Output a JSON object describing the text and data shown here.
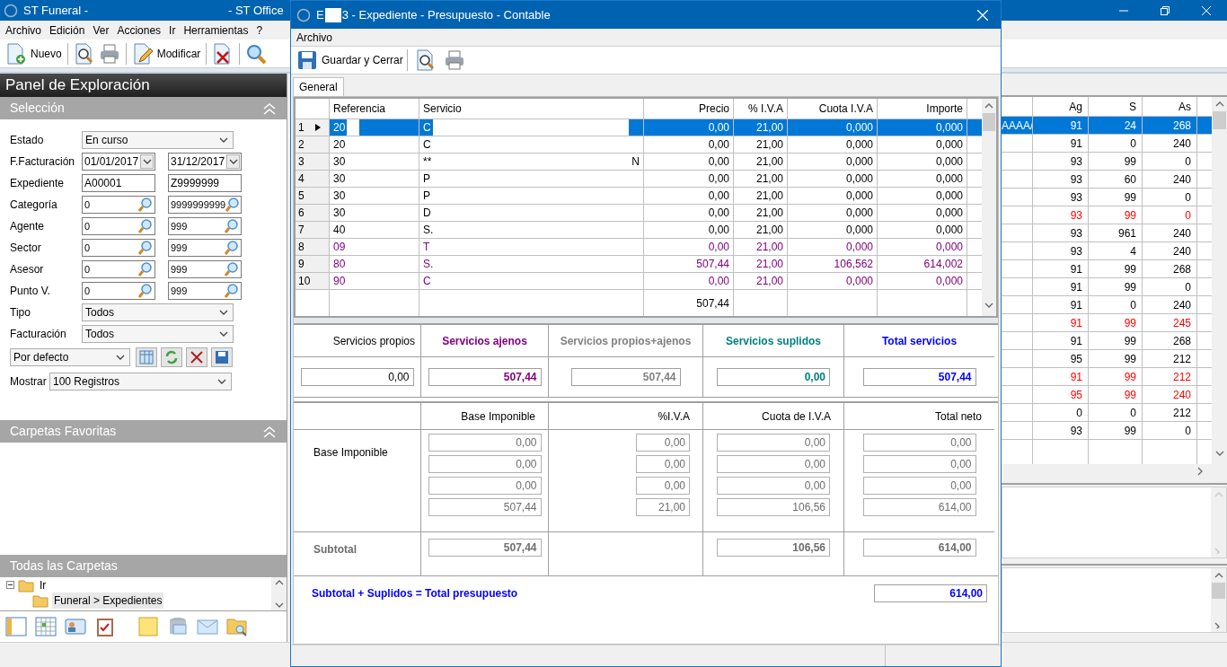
{
  "main_window": {
    "title_left": "ST Funeral -",
    "title_right": "- ST Office"
  },
  "menu": [
    "Archivo",
    "Edición",
    "Ver",
    "Acciones",
    "Ir",
    "Herramientas",
    "?"
  ],
  "toolbar": [
    [
      {
        "kind": "new",
        "label": "Nuevo"
      }
    ],
    [
      {
        "kind": "preview"
      },
      {
        "kind": "print"
      }
    ],
    [
      {
        "kind": "edit",
        "label": "Modificar"
      }
    ],
    [
      {
        "kind": "delete"
      }
    ],
    [
      {
        "kind": "search"
      }
    ]
  ],
  "explorer": {
    "title": "Panel de Exploración",
    "selection": {
      "header": "Selección",
      "fields": [
        {
          "kind": "select",
          "label": "Estado",
          "value": "En curso"
        },
        {
          "kind": "date_range",
          "label": "F.Facturación",
          "from": "01/01/2017",
          "to": "31/12/2017"
        },
        {
          "kind": "text_range",
          "label": "Expediente",
          "from": "A00001",
          "to": "Z9999999"
        },
        {
          "kind": "lookup_range",
          "label": "Categoría",
          "from": "0",
          "to": "9999999999"
        },
        {
          "kind": "lookup_range",
          "label": "Agente",
          "from": "0",
          "to": "999"
        },
        {
          "kind": "lookup_range",
          "label": "Sector",
          "from": "0",
          "to": "999"
        },
        {
          "kind": "lookup_range",
          "label": "Asesor",
          "from": "0",
          "to": "999"
        },
        {
          "kind": "lookup_range",
          "label": "Punto V.",
          "from": "0",
          "to": "999"
        },
        {
          "kind": "select",
          "label": "Tipo",
          "value": "Todos"
        },
        {
          "kind": "select",
          "label": "Facturación",
          "value": "Todos"
        }
      ],
      "view": {
        "value": "Por defecto"
      },
      "show": {
        "label": "Mostrar",
        "value": "100  Registros"
      }
    },
    "favorites": {
      "header": "Carpetas Favoritas"
    },
    "all_folders": {
      "header": "Todas las Carpetas",
      "tree": [
        {
          "label": "Ir",
          "expanded": true,
          "children": [
            {
              "label": "Funeral > Expedientes",
              "selected": true
            }
          ]
        }
      ]
    }
  },
  "background_grid": {
    "columns": [
      "Ag",
      "S",
      "As"
    ],
    "rows": [
      {
        "lead": "AAAA/",
        "cells": [
          "91",
          "24",
          "268"
        ],
        "selected": true
      },
      {
        "cells": [
          "91",
          "0",
          "240"
        ],
        "selected": false,
        "color": "#000000"
      },
      {
        "cells": [
          "93",
          "99",
          "0"
        ],
        "selected": false,
        "color": "#000000"
      },
      {
        "cells": [
          "93",
          "60",
          "240"
        ],
        "selected": false,
        "color": "#000000"
      },
      {
        "cells": [
          "93",
          "99",
          "0"
        ],
        "selected": false,
        "color": "#000000"
      },
      {
        "cells": [
          "93",
          "99",
          "0"
        ],
        "selected": false,
        "color": "#ff0000"
      },
      {
        "cells": [
          "93",
          "961",
          "240"
        ],
        "selected": false,
        "color": "#000000"
      },
      {
        "cells": [
          "93",
          "4",
          "240"
        ],
        "selected": false,
        "color": "#000000"
      },
      {
        "cells": [
          "91",
          "99",
          "268"
        ],
        "selected": false,
        "color": "#000000"
      },
      {
        "cells": [
          "91",
          "99",
          "0"
        ],
        "selected": false,
        "color": "#000000"
      },
      {
        "cells": [
          "91",
          "0",
          "240"
        ],
        "selected": false,
        "color": "#000000"
      },
      {
        "cells": [
          "91",
          "99",
          "245"
        ],
        "selected": false,
        "color": "#ff0000"
      },
      {
        "cells": [
          "91",
          "99",
          "268"
        ],
        "selected": false,
        "color": "#000000"
      },
      {
        "cells": [
          "95",
          "99",
          "212"
        ],
        "selected": false,
        "color": "#000000"
      },
      {
        "cells": [
          "91",
          "99",
          "212"
        ],
        "selected": false,
        "color": "#ff0000"
      },
      {
        "cells": [
          "95",
          "99",
          "240"
        ],
        "selected": false,
        "color": "#ff0000"
      },
      {
        "cells": [
          "0",
          "0",
          "212"
        ],
        "selected": false,
        "color": "#000000"
      },
      {
        "cells": [
          "93",
          "99",
          "0"
        ],
        "selected": false,
        "color": "#000000"
      }
    ]
  },
  "dialog": {
    "title_start": "E",
    "title_end": "3 - Expediente - Presupuesto - Contable",
    "menu": [
      "Archivo"
    ],
    "toolbar": [
      {
        "kind": "save",
        "label": "Guardar y Cerrar"
      },
      {
        "kind": "preview"
      },
      {
        "kind": "print"
      }
    ],
    "tabs": [
      {
        "label": "General",
        "selected": true
      }
    ],
    "grid": {
      "columns": [
        "Referencia",
        "Servicio",
        "Precio",
        "% I.V.A",
        "Cuota I.V.A",
        "Importe"
      ],
      "rows": [
        {
          "number": "1",
          "current": true,
          "selected": true,
          "reference": "20",
          "service": "C",
          "price": "0,00",
          "vat": "21,00",
          "vat_amount": "0,000",
          "amount": "0,000"
        },
        {
          "number": "2",
          "current": false,
          "selected": false,
          "color": "#000000",
          "reference": "20",
          "service": "C",
          "price": "0,00",
          "vat": "21,00",
          "vat_amount": "0,000",
          "amount": "0,000"
        },
        {
          "number": "3",
          "current": false,
          "selected": false,
          "color": "#000000",
          "reference": "30",
          "service": "**",
          "service_tail": "N",
          "price": "0,00",
          "vat": "21,00",
          "vat_amount": "0,000",
          "amount": "0,000"
        },
        {
          "number": "4",
          "current": false,
          "selected": false,
          "color": "#000000",
          "reference": "30",
          "service": "P",
          "price": "0,00",
          "vat": "21,00",
          "vat_amount": "0,000",
          "amount": "0,000"
        },
        {
          "number": "5",
          "current": false,
          "selected": false,
          "color": "#000000",
          "reference": "30",
          "service": "P",
          "price": "0,00",
          "vat": "21,00",
          "vat_amount": "0,000",
          "amount": "0,000"
        },
        {
          "number": "6",
          "current": false,
          "selected": false,
          "color": "#000000",
          "reference": "30",
          "service": "D",
          "price": "0,00",
          "vat": "21,00",
          "vat_amount": "0,000",
          "amount": "0,000"
        },
        {
          "number": "7",
          "current": false,
          "selected": false,
          "color": "#000000",
          "reference": "40",
          "service": "S.",
          "price": "0,00",
          "vat": "21,00",
          "vat_amount": "0,000",
          "amount": "0,000"
        },
        {
          "number": "8",
          "current": false,
          "selected": false,
          "color": "#800080",
          "reference": "09",
          "service": "T",
          "price": "0,00",
          "vat": "21,00",
          "vat_amount": "0,000",
          "amount": "0,000"
        },
        {
          "number": "9",
          "current": false,
          "selected": false,
          "color": "#800080",
          "reference": "80",
          "service": "S.",
          "price": "507,44",
          "vat": "21,00",
          "vat_amount": "106,562",
          "amount": "614,002"
        },
        {
          "number": "10",
          "current": false,
          "selected": false,
          "color": "#800080",
          "reference": "90",
          "service": "C",
          "price": "0,00",
          "vat": "21,00",
          "vat_amount": "0,000",
          "amount": "0,000"
        }
      ],
      "total_price": "507,44"
    },
    "summary": [
      {
        "label": "Servicios propios",
        "value": "0,00",
        "color": "#000000",
        "bold": false
      },
      {
        "label": "Servicios ajenos",
        "value": "507,44",
        "color": "#800080",
        "bold": true
      },
      {
        "label": "Servicios propios+ajenos",
        "value": "507,44",
        "color": "#808080",
        "bold": true
      },
      {
        "label": "Servicios suplidos",
        "value": "0,00",
        "color": "#008080",
        "bold": true
      },
      {
        "label": "Total servicios",
        "value": "507,44",
        "color": "#0000ff",
        "bold": true
      }
    ],
    "taxes": {
      "columns": [
        "Base Imponible",
        "%I.V.A",
        "Cuota de I.V.A",
        "Total neto"
      ],
      "row_label": "Base Imponible",
      "rows": [
        [
          "0,00",
          "0,00",
          "0,00",
          "0,00"
        ],
        [
          "0,00",
          "0,00",
          "0,00",
          "0,00"
        ],
        [
          "0,00",
          "0,00",
          "0,00",
          "0,00"
        ],
        [
          "507,44",
          "21,00",
          "106,56",
          "614,00"
        ]
      ],
      "subtotal": {
        "label": "Subtotal",
        "base": "507,44",
        "vat_amount": "106,56",
        "total": "614,00"
      },
      "grand_total": {
        "label": "Subtotal + Suplidos = Total presupuesto",
        "value": "614,00"
      }
    }
  }
}
